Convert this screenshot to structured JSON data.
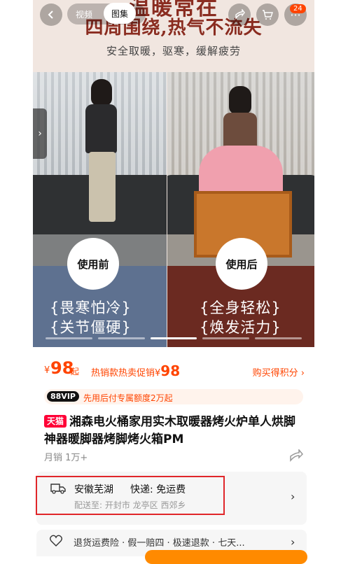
{
  "top_bar": {
    "seg_video": "视频",
    "seg_album": "图集",
    "cart_count": "24"
  },
  "hero": {
    "headline_1": "温暖常在",
    "headline_2": "四周围绕,热气不流失",
    "subline": "安全取暖，驱寒，缓解疲劳",
    "badge_before": "使用前",
    "badge_after": "使用后",
    "left_lines": [
      "{畏寒怕冷}",
      "{关节僵硬}"
    ],
    "right_lines": [
      "{全身轻松}",
      "{焕发活力}"
    ],
    "slides": 5,
    "active_slide": 3
  },
  "price": {
    "currency": "¥",
    "amount": "98",
    "suffix": "起",
    "promo_label": "热销款热卖促销¥",
    "promo_amount": "98",
    "points": "购买得积分 ›"
  },
  "vip": {
    "tag": "88VIP",
    "text": "先用后付专属额度2万起"
  },
  "product": {
    "store_tag": "天猫",
    "title": "湘森电火桶家用实木取暖器烤火炉单人烘脚神器暖脚器烤脚烤火箱PM",
    "sales": "月销 1万+"
  },
  "delivery": {
    "origin": "安徽芜湖",
    "shipping": "快递: 免运费",
    "ship_to": "配送至: 开封市 龙亭区 西郊乡"
  },
  "services": {
    "text": "退货运费险 · 假一赔四 · 极速退款 · 七天..."
  },
  "colors": {
    "accent": "#ff4400",
    "tmall_red": "#ff0036",
    "highlight_box": "#e0262a"
  }
}
